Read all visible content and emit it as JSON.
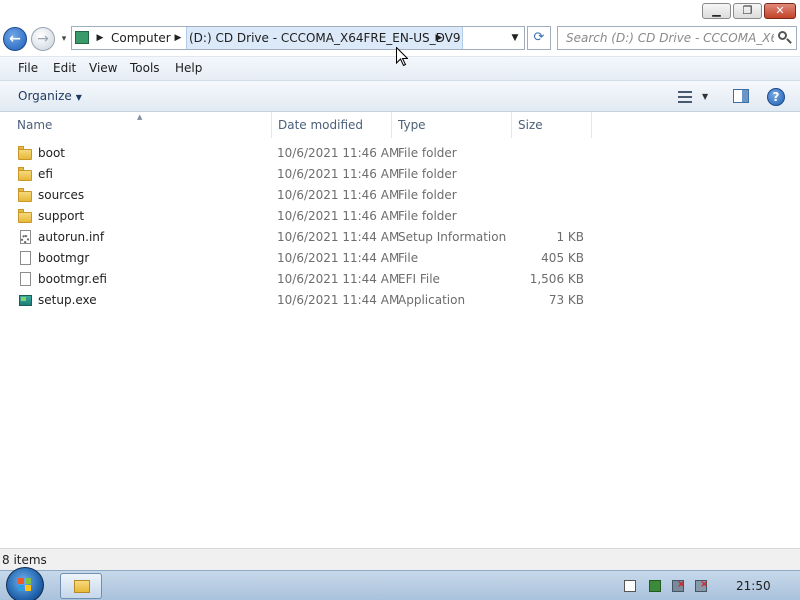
{
  "window": {
    "minimize_glyph": "▁",
    "maximize_glyph": "❐",
    "close_glyph": "✕"
  },
  "nav": {
    "back_glyph": "←",
    "forward_glyph": "→",
    "recent_glyph": "▾",
    "breadcrumbs": [
      {
        "label": "Computer"
      },
      {
        "label": "(D:) CD Drive - CCCOMA_X64FRE_EN-US_DV9"
      }
    ],
    "separator_glyph": "▶",
    "dropdown_glyph": "▼",
    "refresh_glyph": "⟳",
    "search_placeholder": "Search (D:) CD Drive - CCCOMA_X64..."
  },
  "menubar": {
    "items": [
      "File",
      "Edit",
      "View",
      "Tools",
      "Help"
    ]
  },
  "commandbar": {
    "organize_label": "Organize",
    "caret_glyph": "▼",
    "help_glyph": "?"
  },
  "columns": {
    "name": "Name",
    "date": "Date modified",
    "type": "Type",
    "size": "Size",
    "sort_glyph": "▲"
  },
  "files": [
    {
      "name": "boot",
      "date": "10/6/2021 11:46 AM",
      "type": "File folder",
      "size": "",
      "icon": "folder-icon"
    },
    {
      "name": "efi",
      "date": "10/6/2021 11:46 AM",
      "type": "File folder",
      "size": "",
      "icon": "folder-icon"
    },
    {
      "name": "sources",
      "date": "10/6/2021 11:46 AM",
      "type": "File folder",
      "size": "",
      "icon": "folder-icon"
    },
    {
      "name": "support",
      "date": "10/6/2021 11:46 AM",
      "type": "File folder",
      "size": "",
      "icon": "folder-icon"
    },
    {
      "name": "autorun.inf",
      "date": "10/6/2021 11:44 AM",
      "type": "Setup Information",
      "size": "1 KB",
      "icon": "setup-information-icon"
    },
    {
      "name": "bootmgr",
      "date": "10/6/2021 11:44 AM",
      "type": "File",
      "size": "405 KB",
      "icon": "file-icon"
    },
    {
      "name": "bootmgr.efi",
      "date": "10/6/2021 11:44 AM",
      "type": "EFI File",
      "size": "1,506 KB",
      "icon": "file-icon"
    },
    {
      "name": "setup.exe",
      "date": "10/6/2021 11:44 AM",
      "type": "Application",
      "size": "73 KB",
      "icon": "application-icon"
    }
  ],
  "statusbar": {
    "item_count": "8 items"
  },
  "taskbar": {
    "clock": "21:50"
  }
}
